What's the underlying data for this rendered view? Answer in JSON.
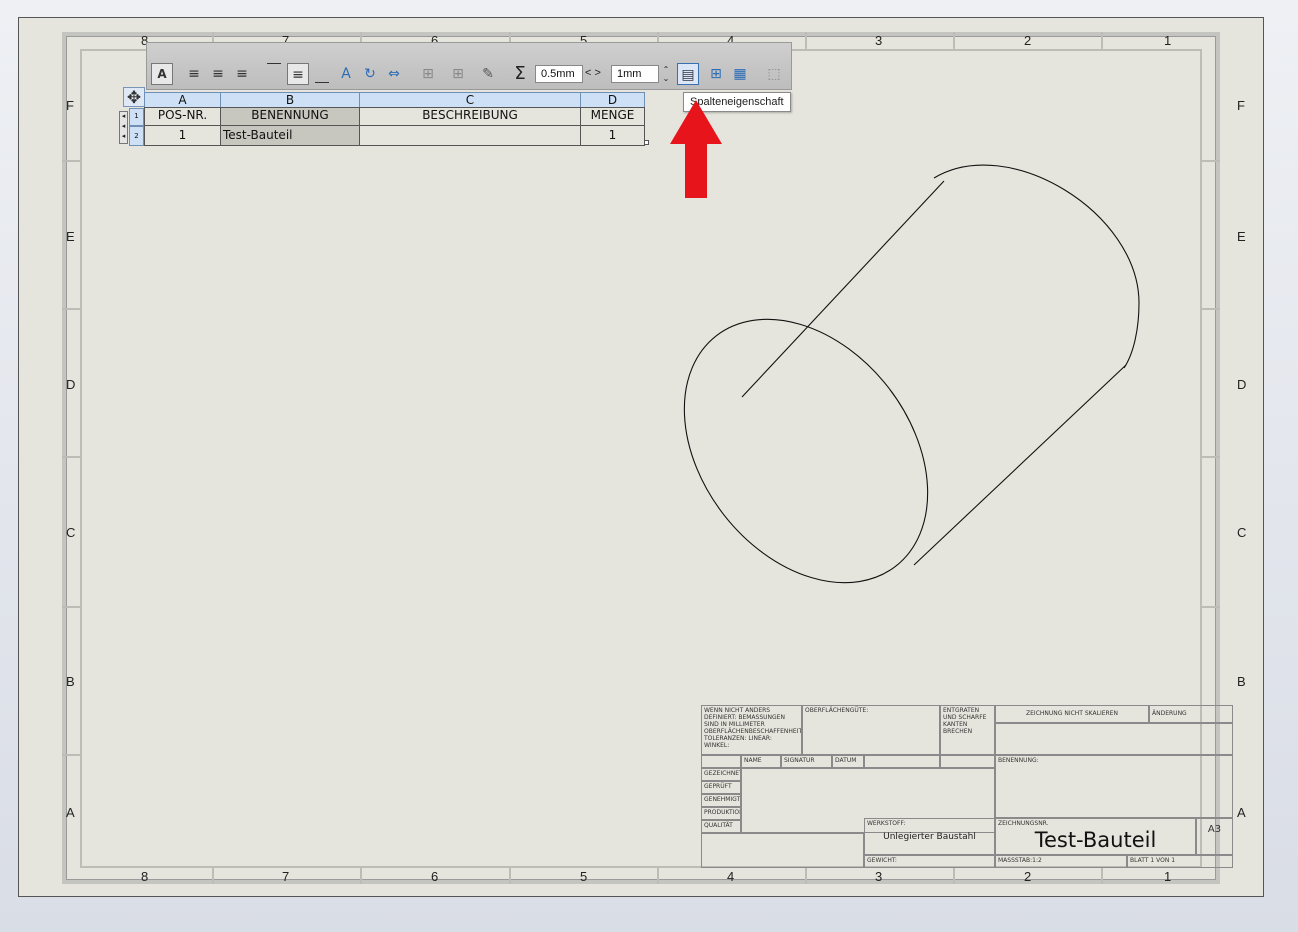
{
  "sheet": {
    "columns_top": [
      "8",
      "7",
      "6",
      "5",
      "4",
      "3",
      "2",
      "1"
    ],
    "columns_bottom": [
      "8",
      "7",
      "6",
      "5",
      "4",
      "3",
      "2",
      "1"
    ],
    "rows_left": [
      "F",
      "E",
      "D",
      "C",
      "B",
      "A"
    ],
    "rows_right": [
      "F",
      "E",
      "D",
      "C",
      "B",
      "A"
    ]
  },
  "toolbar": {
    "line_width_value": "0.5mm",
    "spin_arrows": "< >",
    "spacing_value": "1mm",
    "tooltip": "Spalteneigenschaft",
    "icons": [
      "text-format-icon",
      "align-left-icon",
      "align-center-icon",
      "align-right-icon",
      "align-top-icon",
      "align-middle-icon",
      "align-bottom-icon",
      "text-rotate-icon",
      "rotate-icon",
      "fit-width-icon",
      "insert-row-above-icon",
      "insert-row-below-icon",
      "edit-cell-icon",
      "sum-icon",
      "column-properties-icon",
      "table-split-icon",
      "table-icon",
      "cell-select-icon"
    ]
  },
  "bom": {
    "col_letters": [
      "A",
      "B",
      "C",
      "D"
    ],
    "headers": [
      "POS-NR.",
      "BENENNUNG",
      "BESCHREIBUNG",
      "MENGE"
    ],
    "row_numbers": [
      "1",
      "2"
    ],
    "rows": [
      [
        "1",
        "Test-Bauteil",
        "",
        "1"
      ]
    ]
  },
  "title_block": {
    "note_default": "WENN NICHT ANDERS DEFINIERT: BEMASSUNGEN SIND IN MILLIMETER OBERFLÄCHENBESCHAFFENHEIT: TOLERANZEN: LINEAR: WINKEL:",
    "surface": "OBERFLÄCHENGÜTE:",
    "edges": "ENTGRATEN UND SCHARFE KANTEN BRECHEN",
    "do_not_scale": "ZEICHNUNG NICHT SKALIEREN",
    "revision": "ÄNDERUNG",
    "col_name": "NAME",
    "col_signature": "SIGNATUR",
    "col_date": "DATUM",
    "drawn": "GEZEICHNET",
    "checked": "GEPRÜFT",
    "approved": "GENEHMIGT",
    "production": "PRODUKTION",
    "quality": "QUALITÄT",
    "designation_label": "BENENNUNG:",
    "material_label": "WERKSTOFF:",
    "material_value": "Unlegierter Baustahl",
    "drawing_no_label": "ZEICHNUNGSNR.",
    "drawing_no": "Test-Bauteil",
    "format": "A3",
    "weight_label": "GEWICHT:",
    "scale": "MASSSTAB:1:2",
    "sheet_info": "BLATT 1 VON 1"
  },
  "annotation": {
    "arrow_color": "#e8141c"
  }
}
